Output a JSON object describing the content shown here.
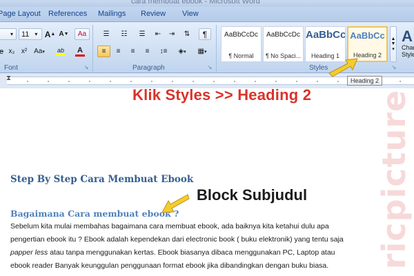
{
  "window": {
    "title": "cara membuat ebook - Microsoft Word"
  },
  "tabs": [
    {
      "label": "Page Layout"
    },
    {
      "label": "References"
    },
    {
      "label": "Mailings"
    },
    {
      "label": "Review"
    },
    {
      "label": "View"
    }
  ],
  "ribbon": {
    "font": {
      "group_label": "Font",
      "size_value": "11",
      "grow_label": "A",
      "shrink_label": "A",
      "clear_label": "Aa",
      "subscript_label": "x₂",
      "superscript_label": "x²",
      "change_case_label": "Aa",
      "highlight_label": "ab",
      "font_color_label": "A"
    },
    "paragraph": {
      "group_label": "Paragraph",
      "pilcrow_label": "¶"
    },
    "styles": {
      "group_label": "Styles",
      "tiles": [
        {
          "sample": "AaBbCcDc",
          "name": "¶ Normal"
        },
        {
          "sample": "AaBbCcDc",
          "name": "¶ No Spaci..."
        },
        {
          "sample": "AaBbCc",
          "name": "Heading 1"
        },
        {
          "sample": "AaBbCc",
          "name": "Heading 2"
        }
      ],
      "change_styles": {
        "glyph": "A",
        "label_line1": "Chan",
        "label_line2": "Style"
      }
    }
  },
  "tooltip": {
    "text": "Heading 2"
  },
  "annotations": {
    "top": "Klik Styles >> Heading 2",
    "block": "Block Subjudul"
  },
  "document": {
    "heading1": "Step By Step Cara Membuat Ebook",
    "heading2": "Bagaimana  Cara membuat  ebook ?",
    "line1": "Sebelum kita mulai membahas bagaimana cara membuat ebook, ada baiknya kita ketahui dulu apa",
    "line2": "pengertian ebook itu ? Ebook adalah kependekan dari electronic book ( buku elektronik) yang tentu saja",
    "line3_italic": "papper less",
    "line3_rest": " atau tanpa menggunakan kertas. Ebook biasanya dibaca menggunakan PC, Laptop atau",
    "line4": "ebook reader  Banyak keunggulan penggunaan format ebook jika dibandingkan dengan buku biasa."
  },
  "watermark": {
    "text": "ricpicture"
  },
  "colors": {
    "annotation_red": "#d9332b",
    "arrow_yellow": "#f5cd2a",
    "heading_blue": "#365f91",
    "subheading_blue": "#4f81bd"
  }
}
